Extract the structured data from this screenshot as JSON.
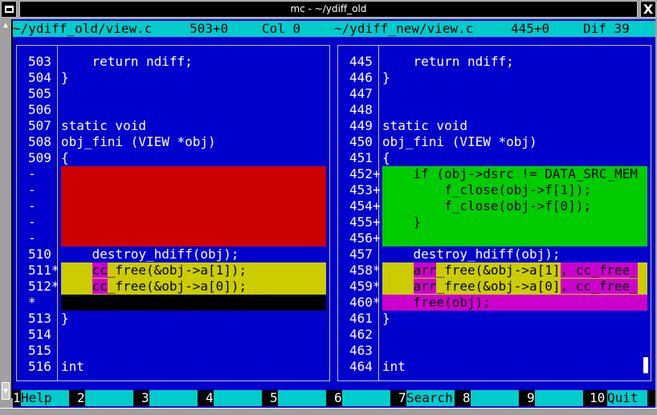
{
  "window": {
    "title": "mc - ~/ydiff_old",
    "close_label": "X"
  },
  "status": {
    "left_file": "~/ydiff_old/view.c",
    "left_pos": "503+0",
    "left_col": "Col 0",
    "right_file": "~/ydiff_new/view.c",
    "right_pos": "445+0",
    "diff_count": "Dif 39"
  },
  "left_panel": {
    "lines": [
      {
        "num": "503",
        "text": "    return ndiff;",
        "type": "normal"
      },
      {
        "num": "504",
        "text": "}",
        "type": "normal"
      },
      {
        "num": "505",
        "text": "",
        "type": "normal"
      },
      {
        "num": "506",
        "text": "",
        "type": "normal"
      },
      {
        "num": "507",
        "text": "static void",
        "type": "normal"
      },
      {
        "num": "508",
        "text": "obj_fini (VIEW *obj)",
        "type": "normal"
      },
      {
        "num": "509",
        "text": "{",
        "type": "normal"
      },
      {
        "num": "-",
        "text": "",
        "type": "del"
      },
      {
        "num": "-",
        "text": "",
        "type": "del"
      },
      {
        "num": "-",
        "text": "",
        "type": "del"
      },
      {
        "num": "-",
        "text": "",
        "type": "del"
      },
      {
        "num": "-",
        "text": "",
        "type": "del"
      },
      {
        "num": "510",
        "text": "    destroy_hdiff(obj);",
        "type": "normal"
      },
      {
        "num": "511*",
        "indent": "    ",
        "hl": "cc",
        "rest": "_free(&obj->a[1]);",
        "type": "chg"
      },
      {
        "num": "512*",
        "indent": "    ",
        "hl": "cc",
        "rest": "_free(&obj->a[0]);",
        "type": "chg"
      },
      {
        "num": "*",
        "text": "",
        "type": "blank"
      },
      {
        "num": "513",
        "text": "}",
        "type": "normal"
      },
      {
        "num": "514",
        "text": "",
        "type": "normal"
      },
      {
        "num": "515",
        "text": "",
        "type": "normal"
      },
      {
        "num": "516",
        "text": "int",
        "type": "normal"
      }
    ]
  },
  "right_panel": {
    "lines": [
      {
        "num": "445",
        "text": "    return ndiff;",
        "type": "normal"
      },
      {
        "num": "446",
        "text": "}",
        "type": "normal"
      },
      {
        "num": "447",
        "text": "",
        "type": "normal"
      },
      {
        "num": "448",
        "text": "",
        "type": "normal"
      },
      {
        "num": "449",
        "text": "static void",
        "type": "normal"
      },
      {
        "num": "450",
        "text": "obj_fini (VIEW *obj)",
        "type": "normal"
      },
      {
        "num": "451",
        "text": "{",
        "type": "normal"
      },
      {
        "num": "452+",
        "text": "    if (obj->dsrc != DATA_SRC_MEM",
        "type": "add"
      },
      {
        "num": "453+",
        "text": "        f_close(obj->f[1]);",
        "type": "add"
      },
      {
        "num": "454+",
        "text": "        f_close(obj->f[0]);",
        "type": "add"
      },
      {
        "num": "455+",
        "text": "    }",
        "type": "add"
      },
      {
        "num": "456+",
        "text": "",
        "type": "add"
      },
      {
        "num": "457",
        "text": "    destroy_hdiff(obj);",
        "type": "normal"
      },
      {
        "num": "458*",
        "indent": "    ",
        "hl": "arr",
        "mid": "_free(&obj->a[1]",
        "rest": ", cc_free_",
        "type": "chg-right"
      },
      {
        "num": "459*",
        "indent": "    ",
        "hl": "arr",
        "mid": "_free(&obj->a[0]",
        "rest": ", cc_free_",
        "type": "chg-right"
      },
      {
        "num": "460*",
        "text": "    free(obj);",
        "type": "chg2"
      },
      {
        "num": "461",
        "text": "}",
        "type": "normal"
      },
      {
        "num": "462",
        "text": "",
        "type": "normal"
      },
      {
        "num": "463",
        "text": "",
        "type": "normal"
      },
      {
        "num": "464",
        "text": "int",
        "type": "normal"
      }
    ]
  },
  "fkeys": [
    {
      "num": "1",
      "label": "Help"
    },
    {
      "num": "2",
      "label": ""
    },
    {
      "num": "3",
      "label": ""
    },
    {
      "num": "4",
      "label": ""
    },
    {
      "num": "5",
      "label": ""
    },
    {
      "num": "6",
      "label": ""
    },
    {
      "num": "7",
      "label": "Search"
    },
    {
      "num": "8",
      "label": ""
    },
    {
      "num": "9",
      "label": ""
    },
    {
      "num": "10",
      "label": "Quit"
    }
  ],
  "colors": {
    "background": "#0000cc",
    "status_bar": "#00cccc",
    "deleted": "#cc0000",
    "added": "#00cc00",
    "changed": "#cccc00",
    "changed_text": "#cc00cc"
  }
}
